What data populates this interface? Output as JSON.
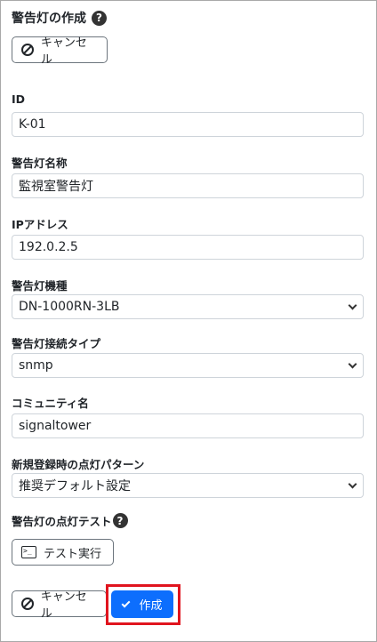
{
  "header": {
    "title": "警告灯の作成",
    "help": "?"
  },
  "buttons": {
    "cancel_label": "キャンセル",
    "test_label": "テスト実行",
    "create_label": "作成"
  },
  "fields": {
    "id": {
      "label": "ID",
      "value": "K-01"
    },
    "name": {
      "label": "警告灯名称",
      "value": "監視室警告灯"
    },
    "ip": {
      "label": "IPアドレス",
      "value": "192.0.2.5"
    },
    "model": {
      "label": "警告灯機種",
      "value": "DN-1000RN-3LB"
    },
    "conn": {
      "label": "警告灯接続タイプ",
      "value": "snmp"
    },
    "community": {
      "label": "コミュニティ名",
      "value": "signaltower"
    },
    "pattern": {
      "label": "新規登録時の点灯パターン",
      "value": "推奨デフォルト設定"
    },
    "test": {
      "label": "警告灯の点灯テスト"
    }
  },
  "colors": {
    "primary": "#0d6efd",
    "highlight": "#e0141e"
  }
}
